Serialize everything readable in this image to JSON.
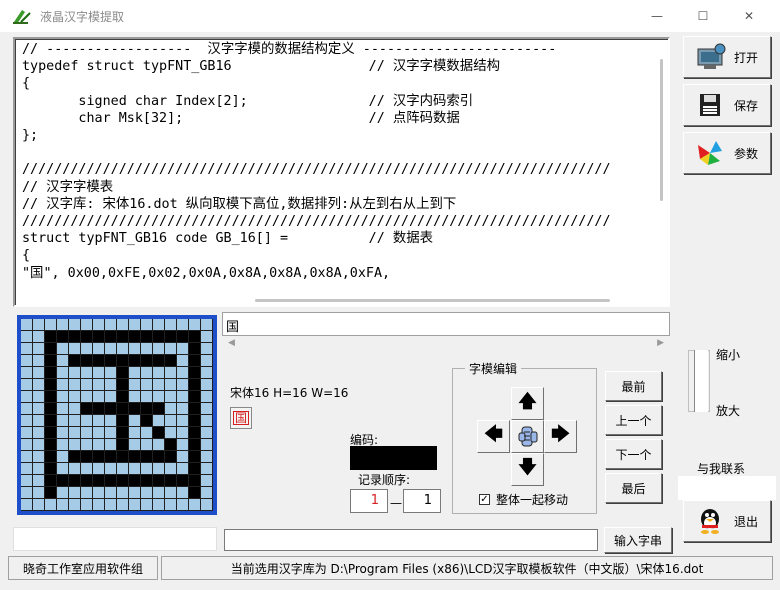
{
  "window": {
    "title": "液晶汉字模提取",
    "min_glyph": "—",
    "max_glyph": "☐",
    "close_glyph": "✕"
  },
  "code_lines": [
    "// ------------------  汉字字模的数据结构定义 ------------------------",
    "typedef struct typFNT_GB16                 // 汉字字模数据结构",
    "{",
    "       signed char Index[2];               // 汉字内码索引",
    "       char Msk[32];                       // 点阵码数据",
    "};",
    "",
    "/////////////////////////////////////////////////////////////////////////",
    "// 汉字字模表",
    "// 汉字库: 宋体16.dot 纵向取模下高位,数据排列:从左到右从上到下",
    "/////////////////////////////////////////////////////////////////////////",
    "struct typFNT_GB16 code GB_16[] =          // 数据表",
    "{",
    "\"国\", 0x00,0xFE,0x02,0x0A,0x8A,0x8A,0x8A,0xFA,"
  ],
  "sidebar": {
    "open": "打开",
    "save": "保存",
    "params": "参数",
    "exit": "退出"
  },
  "glyph_grid": [
    "0000000000000000",
    "0011111111111110",
    "0010000000000010",
    "0010111111111010",
    "0010000010000010",
    "0010000010000010",
    "0010000010000010",
    "0010011111110010",
    "0010000010100010",
    "0010000010010010",
    "0010000010001010",
    "0010111111111010",
    "0010000000000010",
    "0011111111111110",
    "0010000000000010",
    "0000000000000000"
  ],
  "char_input": {
    "value": "国"
  },
  "font_info": "宋体16 H=16 W=16",
  "mini_char": "国",
  "code_label": "编码:",
  "order_label": "记录顺序:",
  "order_start": "1",
  "order_dash": "—",
  "order_end": "1",
  "editor": {
    "title": "字模编辑",
    "move_all_label": "整体一起移动",
    "move_all_checked": "✓",
    "up": "🡅",
    "down": "🡇",
    "left": "🡄",
    "right": "🡆"
  },
  "nav": {
    "first": "最前",
    "prev": "上一个",
    "next": "下一个",
    "last": "最后"
  },
  "zoom": {
    "in": "缩小",
    "out": "放大"
  },
  "contact": "与我联系",
  "enter_button": "输入字串",
  "status": {
    "left": "晓奇工作室应用软件组",
    "right": "当前选用汉字库为 D:\\Program Files (x86)\\LCD汉字取模板软件（中文版）\\宋体16.dot"
  }
}
